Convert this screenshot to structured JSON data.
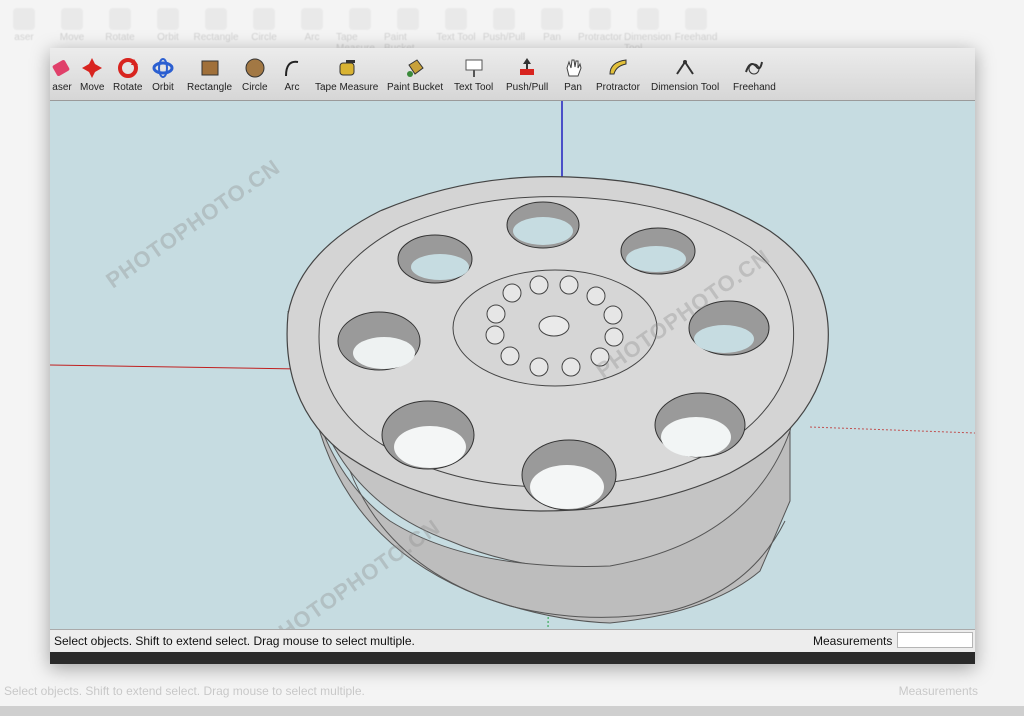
{
  "toolbar": {
    "tools": [
      {
        "label": "aser",
        "icon": "eraser-icon",
        "color": "#e0406a"
      },
      {
        "label": "Move",
        "icon": "move-icon",
        "color": "#d8241f"
      },
      {
        "label": "Rotate",
        "icon": "rotate-icon",
        "color": "#d8241f"
      },
      {
        "label": "Orbit",
        "icon": "orbit-icon",
        "color": "#2b5fd1"
      },
      {
        "label": "Rectangle",
        "icon": "rectangle-icon",
        "color": "#a0703a"
      },
      {
        "label": "Circle",
        "icon": "circle-icon",
        "color": "#a27844"
      },
      {
        "label": "Arc",
        "icon": "arc-icon",
        "color": "#222222"
      },
      {
        "label": "Tape Measure",
        "icon": "tape-measure-icon",
        "color": "#d9b332"
      },
      {
        "label": "Paint Bucket",
        "icon": "paint-bucket-icon",
        "color": "#c8a13a"
      },
      {
        "label": "Text Tool",
        "icon": "text-tool-icon",
        "color": "#555555"
      },
      {
        "label": "Push/Pull",
        "icon": "push-pull-icon",
        "color": "#d8241f"
      },
      {
        "label": "Pan",
        "icon": "pan-icon",
        "color": "#444444"
      },
      {
        "label": "Protractor",
        "icon": "protractor-icon",
        "color": "#e2c03a"
      },
      {
        "label": "Dimension Tool",
        "icon": "dimension-tool-icon",
        "color": "#333333"
      },
      {
        "label": "Freehand",
        "icon": "freehand-icon",
        "color": "#333333"
      }
    ]
  },
  "background_toolbar": {
    "labels": [
      "aser",
      "Move",
      "Rotate",
      "Orbit",
      "Rectangle",
      "Circle",
      "Arc",
      "Tape Measure",
      "Paint Bucket",
      "Text Tool",
      "Push/Pull",
      "Pan",
      "Protractor",
      "Dimension Tool",
      "Freehand"
    ]
  },
  "status": {
    "text": "Select objects. Shift to extend select. Drag mouse to select multiple.",
    "measurements_label": "Measurements",
    "measurements_value": ""
  },
  "watermark": {
    "text": "PHOTOPHOTO.CN"
  },
  "colors": {
    "viewport_bg": "#c6dce1",
    "model_face": "#d2d2d2",
    "axis_red": "#c02020",
    "axis_blue": "#2020c0",
    "axis_green": "#20a040"
  }
}
